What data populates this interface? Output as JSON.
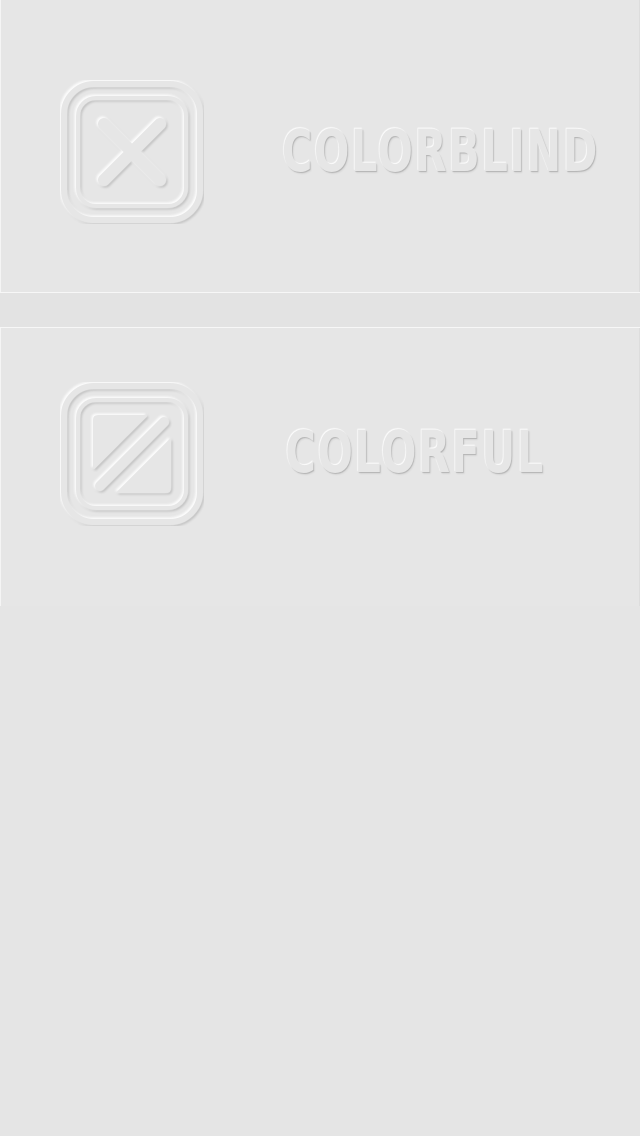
{
  "options": [
    {
      "id": "colorblind",
      "label": "COLORBLIND",
      "icon": "x-square-icon"
    },
    {
      "id": "colorful",
      "label": "COLORFUL",
      "icon": "split-square-icon"
    }
  ],
  "colors": {
    "background": "#e5e5e5",
    "emboss_highlight": "#ffffff",
    "emboss_shadow": "#bdbdbd"
  }
}
